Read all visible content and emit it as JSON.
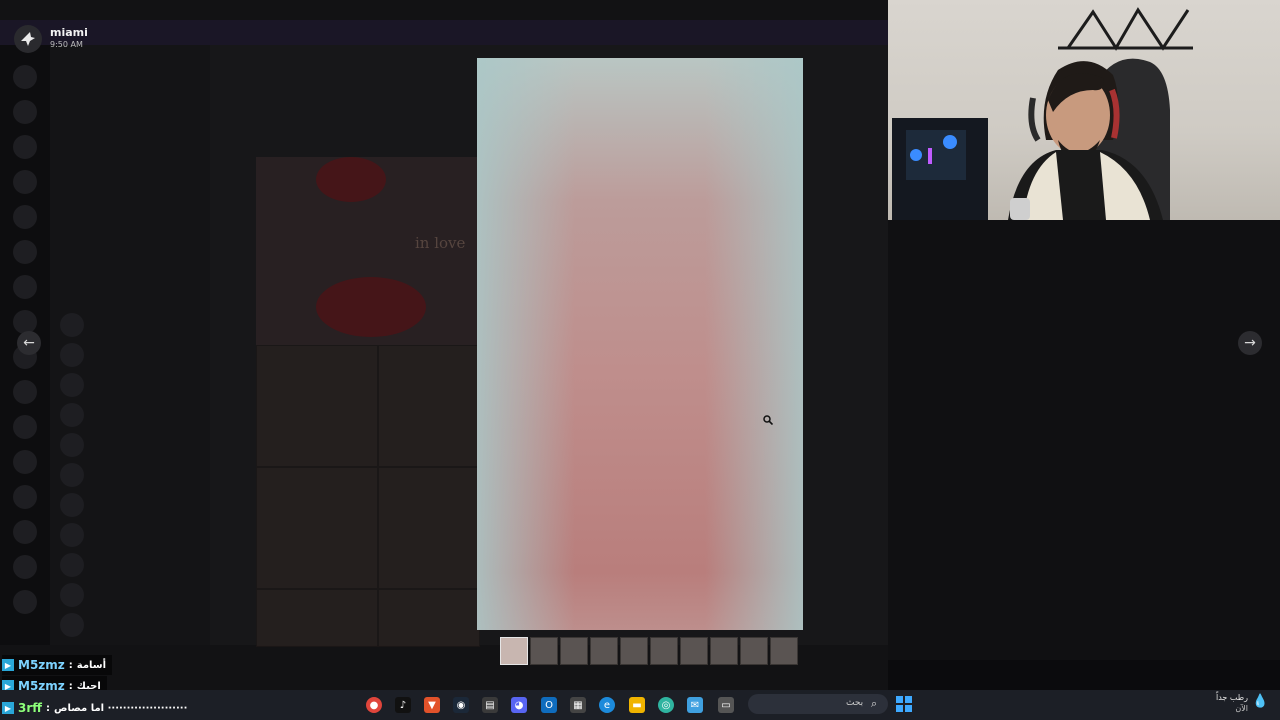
{
  "dm": {
    "user_name": "miami",
    "time": "9:50 AM"
  },
  "collage_text": "in love",
  "viewer": {
    "prev_icon": "arrow-left-icon",
    "next_icon": "arrow-right-icon",
    "prev_glyph": "←",
    "next_glyph": "→",
    "thumbnail_count": 10
  },
  "chat": [
    {
      "user": "M5zmz",
      "message": "أسامة",
      "color": "#7dd3ff"
    },
    {
      "user": "M5zmz",
      "message": "احبك",
      "color": "#7dd3ff"
    },
    {
      "user": "3rff",
      "message": "اما مصاص ·····················",
      "color": "#8dff7a"
    }
  ],
  "taskbar": {
    "search_placeholder": "بحث",
    "weather_title": "رطب جداً",
    "weather_sub": "الآن",
    "icons": [
      "chrome-icon",
      "tiktok-icon",
      "brave-icon",
      "steam-icon",
      "app-icon",
      "discord-icon",
      "outlook-icon",
      "store-icon",
      "edge-icon",
      "folder-icon",
      "copilot-icon",
      "chat-app-icon",
      "window-icon",
      "widget-icon"
    ]
  },
  "colors": {
    "accent": "#3ea9ff",
    "chat_name": "#7dd3ff",
    "chat_name_alt": "#8dff7a"
  }
}
